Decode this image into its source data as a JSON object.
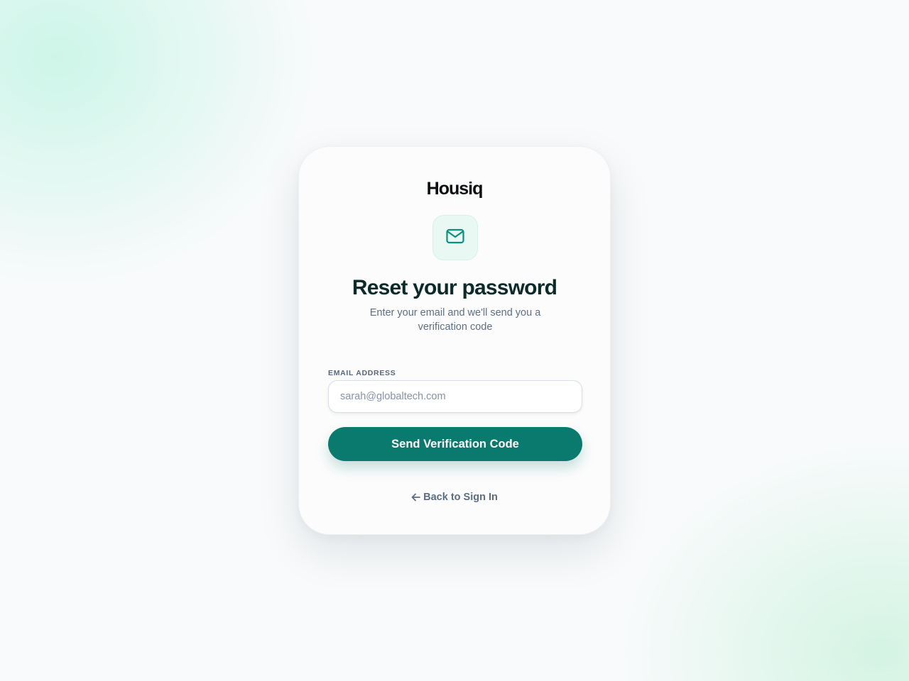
{
  "brand": {
    "logo_text": "Housiq"
  },
  "icons": {
    "header_icon": "mail-icon",
    "back_icon": "arrow-left-icon"
  },
  "heading": {
    "title": "Reset your password",
    "subtitle": "Enter your email and we'll send you a verification code"
  },
  "form": {
    "email_label": "EMAIL ADDRESS",
    "email_placeholder": "sarah@globaltech.com",
    "email_value": "",
    "submit_label": "Send Verification Code"
  },
  "footer": {
    "back_label": "Back to Sign In"
  },
  "colors": {
    "accent": "#0b7a6e",
    "icon_bg": "#e9f8f3",
    "heading": "#0c2a2a",
    "muted_text": "#5e6f82"
  }
}
